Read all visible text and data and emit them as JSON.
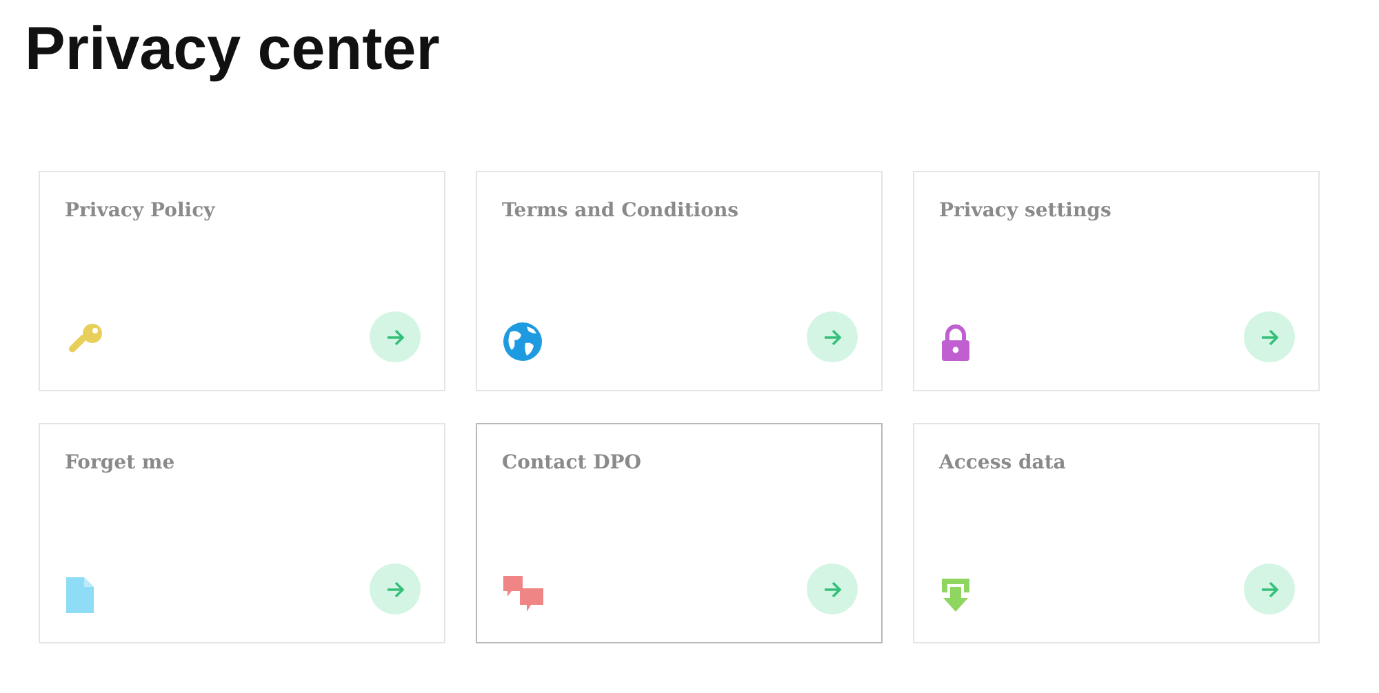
{
  "title": "Privacy center",
  "cards": [
    {
      "label": "Privacy Policy",
      "kind": "key",
      "selected": false
    },
    {
      "label": "Terms and Conditions",
      "kind": "globe",
      "selected": false
    },
    {
      "label": "Privacy settings",
      "kind": "lock",
      "selected": false
    },
    {
      "label": "Forget me",
      "kind": "document",
      "selected": false
    },
    {
      "label": "Contact DPO",
      "kind": "chat",
      "selected": true
    },
    {
      "label": "Access data",
      "kind": "download",
      "selected": false
    }
  ]
}
